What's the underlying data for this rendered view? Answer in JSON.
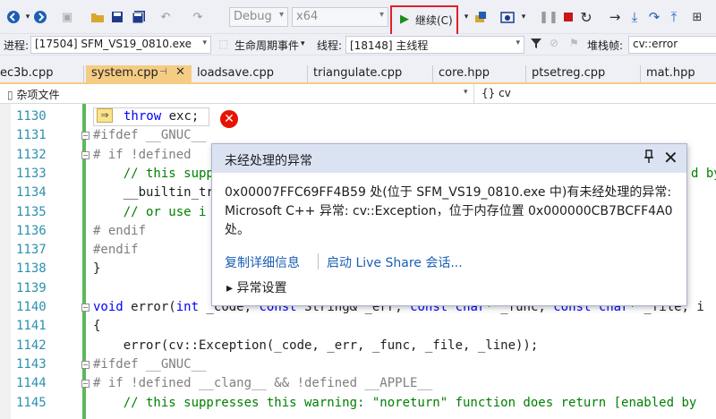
{
  "toolbar": {
    "config_select": "Debug",
    "platform_select": "x64",
    "continue_label": "继续(C)"
  },
  "procbar": {
    "process_label": "进程:",
    "process_value": "[17504] SFM_VS19_0810.exe",
    "lifecycle_label": "生命周期事件",
    "thread_label": "线程:",
    "thread_value": "[18148] 主线程",
    "stackframe_label": "堆栈帧:",
    "stackframe_value": "cv::error"
  },
  "tabs": [
    {
      "label": "ec3b.cpp"
    },
    {
      "label": "system.cpp"
    },
    {
      "label": "loadsave.cpp"
    },
    {
      "label": "triangulate.cpp"
    },
    {
      "label": "core.hpp"
    },
    {
      "label": "ptsetreg.cpp"
    },
    {
      "label": "mat.hpp"
    }
  ],
  "navbar": {
    "scope": "杂项文件",
    "member": "cv"
  },
  "editor": {
    "lines": [
      {
        "num": "1130",
        "code": "throw exc;"
      },
      {
        "num": "1131",
        "code": "#ifdef __GNUC__"
      },
      {
        "num": "1132",
        "code": "# if !defined"
      },
      {
        "num": "1133",
        "code": "    // this supp"
      },
      {
        "num": "1134",
        "code": "    __builtin_tr"
      },
      {
        "num": "1135",
        "code": "    // or use i"
      },
      {
        "num": "1136",
        "code": "# endif"
      },
      {
        "num": "1137",
        "code": "#endif"
      },
      {
        "num": "1138",
        "code": "}"
      },
      {
        "num": "1139",
        "code": ""
      },
      {
        "num": "1140",
        "code": "void error(int _code, const String& _err, const char* _func, const char* _file, i"
      },
      {
        "num": "1141",
        "code": "{"
      },
      {
        "num": "1142",
        "code": "    error(cv::Exception(_code, _err, _func, _file, _line));"
      },
      {
        "num": "1143",
        "code": "#ifdef __GNUC__"
      },
      {
        "num": "1144",
        "code": "# if !defined __clang__ && !defined __APPLE__"
      },
      {
        "num": "1145",
        "code": "    // this suppresses this warning: \"noreturn\" function does return [enabled by"
      }
    ],
    "line_1133_tail": "d by",
    "line_1145_tail": "d by"
  },
  "popup": {
    "title": "未经处理的异常",
    "message": "0x00007FFC69FF4B59 处(位于 SFM_VS19_0810.exe 中)有未经处理的异常: Microsoft C++ 异常: cv::Exception，位于内存位置 0x000000CB7BCFF4A0 处。",
    "link_copy": "复制详细信息",
    "link_liveshare": "启动 Live Share 会话...",
    "settings_label": "异常设置"
  },
  "colors": {
    "accent_red_box": "#e0202a",
    "active_tab": "#f5cc84",
    "error_icon": "#e51400",
    "keyword": "#0000ff",
    "comment": "#008000",
    "line_number": "#2b91af"
  }
}
